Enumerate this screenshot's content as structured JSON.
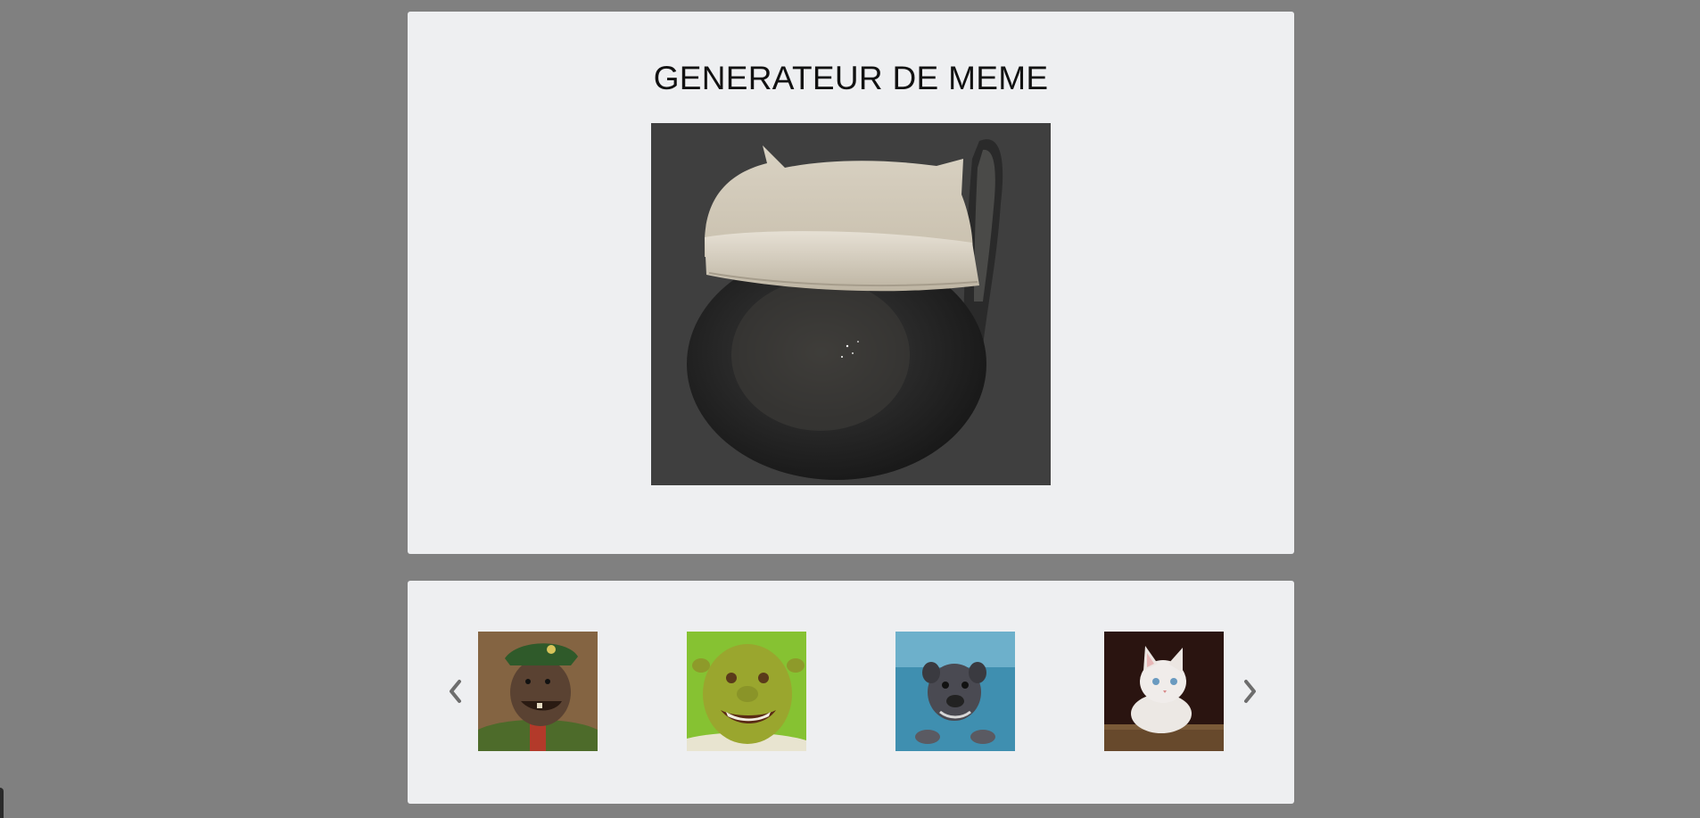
{
  "app": {
    "title": "GENERATEUR DE MEME"
  },
  "meme": {
    "image_alt": "cat in hat meme",
    "image_icon": "cat-hat-image"
  },
  "gallery": {
    "prev_icon": "chevron-left-icon",
    "next_icon": "chevron-right-icon",
    "thumbnails": [
      {
        "alt": "laughing general",
        "icon": "general-image"
      },
      {
        "alt": "shrek",
        "icon": "shrek-image"
      },
      {
        "alt": "underwater dog",
        "icon": "dog-image"
      },
      {
        "alt": "white kitten",
        "icon": "kitten-image"
      }
    ]
  },
  "colors": {
    "background": "#808080",
    "panel": "#eeeff1",
    "arrow": "#6d6d6d"
  }
}
